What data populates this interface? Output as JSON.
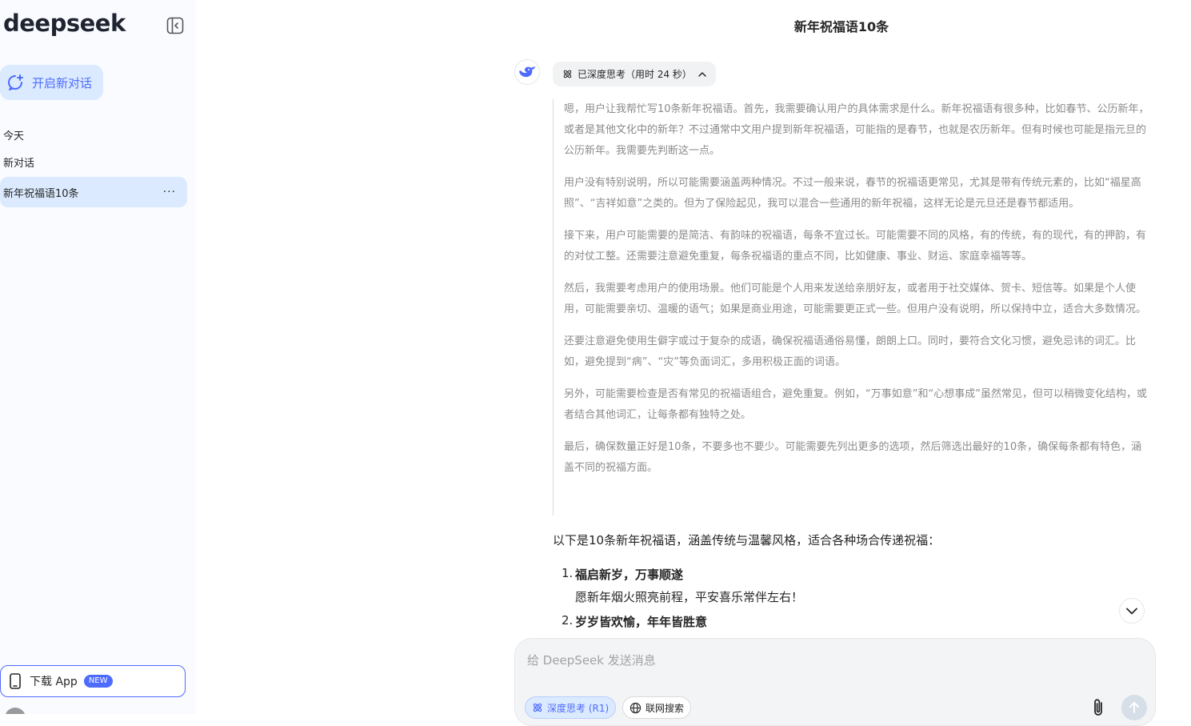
{
  "sidebar": {
    "logo": "deepseek",
    "new_chat_label": "开启新对话",
    "section_today": "今天",
    "conversations": [
      {
        "label": "新对话"
      },
      {
        "label": "新年祝福语10条"
      }
    ],
    "more_glyph": "···",
    "download_label": "下载 App",
    "download_badge": "NEW"
  },
  "chat": {
    "title": "新年祝福语10条",
    "thinking_chip": "已深度思考（用时 24 秒）",
    "thinking_paragraphs": [
      "嗯，用户让我帮忙写10条新年祝福语。首先，我需要确认用户的具体需求是什么。新年祝福语有很多种，比如春节、公历新年，或者是其他文化中的新年？不过通常中文用户提到新年祝福语，可能指的是春节，也就是农历新年。但有时候也可能是指元旦的公历新年。我需要先判断这一点。",
      "用户没有特别说明，所以可能需要涵盖两种情况。不过一般来说，春节的祝福语更常见，尤其是带有传统元素的，比如“福星高照”、“吉祥如意”之类的。但为了保险起见，我可以混合一些通用的新年祝福，这样无论是元旦还是春节都适用。",
      "接下来，用户可能需要的是简洁、有韵味的祝福语，每条不宜过长。可能需要不同的风格，有的传统，有的现代，有的押韵，有的对仗工整。还需要注意避免重复，每条祝福语的重点不同，比如健康、事业、财运、家庭幸福等等。",
      "然后，我需要考虑用户的使用场景。他们可能是个人用来发送给亲朋好友，或者用于社交媒体、贺卡、短信等。如果是个人使用，可能需要亲切、温暖的语气；如果是商业用途，可能需要更正式一些。但用户没有说明，所以保持中立，适合大多数情况。",
      "还要注意避免使用生僻字或过于复杂的成语，确保祝福语通俗易懂，朗朗上口。同时，要符合文化习惯，避免忌讳的词汇。比如，避免提到“病”、“灾”等负面词汇，多用积极正面的词语。",
      "另外，可能需要检查是否有常见的祝福语组合，避免重复。例如，“万事如意”和“心想事成”虽然常见，但可以稍微变化结构，或者结合其他词汇，让每条都有独特之处。",
      "最后，确保数量正好是10条，不要多也不要少。可能需要先列出更多的选项，然后筛选出最好的10条，确保每条都有特色，涵盖不同的祝福方面。"
    ],
    "answer_intro": "以下是10条新年祝福语，涵盖传统与温馨风格，适合各种场合传递祝福：",
    "items": [
      {
        "num": "1.",
        "title": "福启新岁，万事顺遂",
        "body": "愿新年烟火照亮前程，平安喜乐常伴左右！"
      },
      {
        "num": "2.",
        "title": "岁岁皆欢愉，年年皆胜意",
        "body": ""
      }
    ]
  },
  "composer": {
    "placeholder": "给 DeepSeek 发送消息",
    "deep_think_label": "深度思考 (R1)",
    "web_search_label": "联网搜索"
  },
  "colors": {
    "accent": "#4d6bfe",
    "accent_light": "#dbeafe",
    "sidebar_bg": "#f9fbff",
    "thinking_text": "#8b8b8b"
  },
  "icons": [
    "collapse-sidebar-icon",
    "new-chat-icon",
    "phone-icon",
    "whale-logo-icon",
    "atom-icon",
    "chevron-up-icon",
    "chevron-down-icon",
    "globe-icon",
    "paperclip-icon",
    "arrow-up-icon"
  ]
}
